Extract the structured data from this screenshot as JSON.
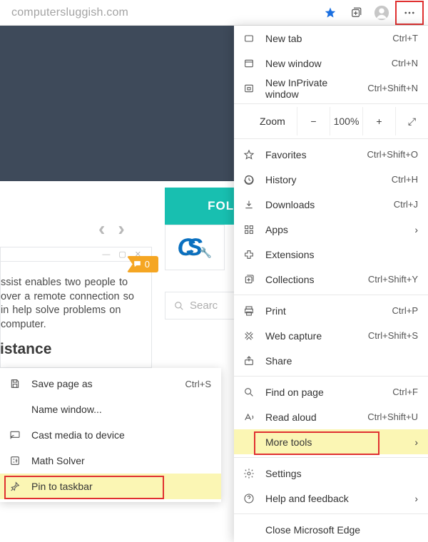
{
  "url": "computersluggish.com",
  "menu": {
    "new_tab": {
      "label": "New tab",
      "shortcut": "Ctrl+T"
    },
    "new_window": {
      "label": "New window",
      "shortcut": "Ctrl+N"
    },
    "new_inprivate": {
      "label": "New InPrivate window",
      "shortcut": "Ctrl+Shift+N"
    },
    "zoom": {
      "label": "Zoom",
      "value": "100%"
    },
    "favorites": {
      "label": "Favorites",
      "shortcut": "Ctrl+Shift+O"
    },
    "history": {
      "label": "History",
      "shortcut": "Ctrl+H"
    },
    "downloads": {
      "label": "Downloads",
      "shortcut": "Ctrl+J"
    },
    "apps": {
      "label": "Apps"
    },
    "extensions": {
      "label": "Extensions"
    },
    "collections": {
      "label": "Collections",
      "shortcut": "Ctrl+Shift+Y"
    },
    "print": {
      "label": "Print",
      "shortcut": "Ctrl+P"
    },
    "web_capture": {
      "label": "Web capture",
      "shortcut": "Ctrl+Shift+S"
    },
    "share": {
      "label": "Share"
    },
    "find": {
      "label": "Find on page",
      "shortcut": "Ctrl+F"
    },
    "read_aloud": {
      "label": "Read aloud",
      "shortcut": "Ctrl+Shift+U"
    },
    "more_tools": {
      "label": "More tools"
    },
    "settings": {
      "label": "Settings"
    },
    "help": {
      "label": "Help and feedback"
    },
    "close": {
      "label": "Close Microsoft Edge"
    }
  },
  "submenu": {
    "save_as": {
      "label": "Save page as",
      "shortcut": "Ctrl+S"
    },
    "name_window": {
      "label": "Name window..."
    },
    "cast": {
      "label": "Cast media to device"
    },
    "math": {
      "label": "Math Solver"
    },
    "pin": {
      "label": "Pin to taskbar"
    }
  },
  "page": {
    "follow": "FOLLOW",
    "card_text": "ssist enables two people to over a remote connection so in help solve problems on computer.",
    "heading": "istance",
    "comment_count": "0",
    "search_placeholder": "Searc"
  }
}
